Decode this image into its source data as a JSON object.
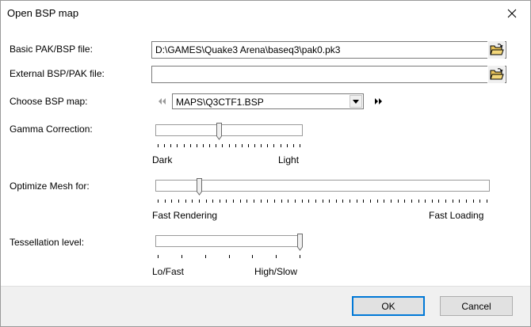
{
  "window": {
    "title": "Open BSP map"
  },
  "fields": {
    "basic_pak": {
      "label": "Basic PAK/BSP file:",
      "value": "D:\\GAMES\\Quake3 Arena\\baseq3\\pak0.pk3"
    },
    "external_pak": {
      "label": "External BSP/PAK file:",
      "value": ""
    }
  },
  "bsp_map": {
    "label": "Choose BSP map:",
    "selected": "MAPS\\Q3CTF1.BSP",
    "prev_icon": "double-chevron-left-icon",
    "next_icon": "double-chevron-right-icon"
  },
  "gamma": {
    "label": "Gamma Correction:",
    "min_label": "Dark",
    "max_label": "Light",
    "position": 0.42,
    "tick_count": 23
  },
  "optimize": {
    "label": "Optimize Mesh for:",
    "min_label": "Fast Rendering",
    "max_label": "Fast Loading",
    "position": 0.12,
    "tick_count": 49
  },
  "tessellation": {
    "label": "Tessellation level:",
    "min_label": "Lo/Fast",
    "max_label": "High/Slow",
    "position": 1.0,
    "tick_count": 7
  },
  "buttons": {
    "ok": "OK",
    "cancel": "Cancel"
  },
  "colors": {
    "accent": "#0078d7",
    "folder": "#e8c35a"
  }
}
